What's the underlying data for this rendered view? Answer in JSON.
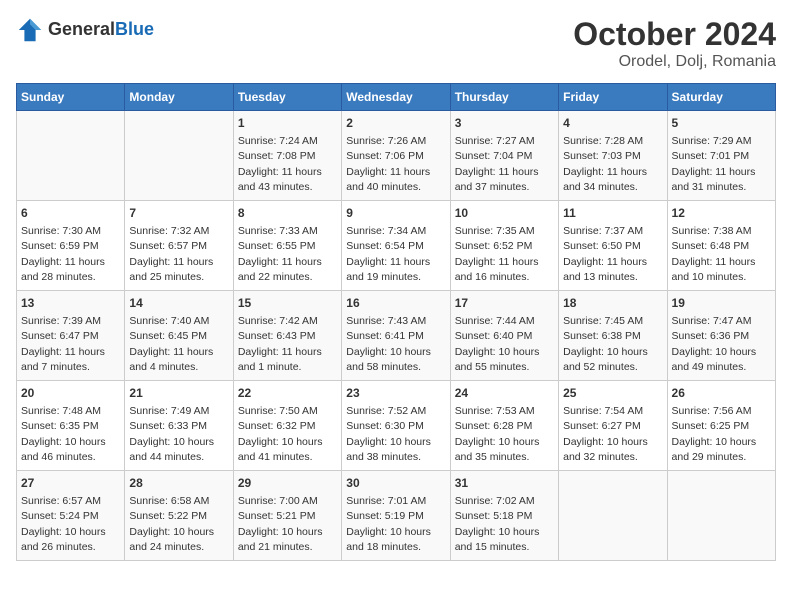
{
  "header": {
    "logo_general": "General",
    "logo_blue": "Blue",
    "title": "October 2024",
    "subtitle": "Orodel, Dolj, Romania"
  },
  "days_of_week": [
    "Sunday",
    "Monday",
    "Tuesday",
    "Wednesday",
    "Thursday",
    "Friday",
    "Saturday"
  ],
  "weeks": [
    [
      {
        "day": null
      },
      {
        "day": null
      },
      {
        "day": "1",
        "sunrise": "7:24 AM",
        "sunset": "7:08 PM",
        "daylight": "11 hours and 43 minutes."
      },
      {
        "day": "2",
        "sunrise": "7:26 AM",
        "sunset": "7:06 PM",
        "daylight": "11 hours and 40 minutes."
      },
      {
        "day": "3",
        "sunrise": "7:27 AM",
        "sunset": "7:04 PM",
        "daylight": "11 hours and 37 minutes."
      },
      {
        "day": "4",
        "sunrise": "7:28 AM",
        "sunset": "7:03 PM",
        "daylight": "11 hours and 34 minutes."
      },
      {
        "day": "5",
        "sunrise": "7:29 AM",
        "sunset": "7:01 PM",
        "daylight": "11 hours and 31 minutes."
      }
    ],
    [
      {
        "day": "6",
        "sunrise": "7:30 AM",
        "sunset": "6:59 PM",
        "daylight": "11 hours and 28 minutes."
      },
      {
        "day": "7",
        "sunrise": "7:32 AM",
        "sunset": "6:57 PM",
        "daylight": "11 hours and 25 minutes."
      },
      {
        "day": "8",
        "sunrise": "7:33 AM",
        "sunset": "6:55 PM",
        "daylight": "11 hours and 22 minutes."
      },
      {
        "day": "9",
        "sunrise": "7:34 AM",
        "sunset": "6:54 PM",
        "daylight": "11 hours and 19 minutes."
      },
      {
        "day": "10",
        "sunrise": "7:35 AM",
        "sunset": "6:52 PM",
        "daylight": "11 hours and 16 minutes."
      },
      {
        "day": "11",
        "sunrise": "7:37 AM",
        "sunset": "6:50 PM",
        "daylight": "11 hours and 13 minutes."
      },
      {
        "day": "12",
        "sunrise": "7:38 AM",
        "sunset": "6:48 PM",
        "daylight": "11 hours and 10 minutes."
      }
    ],
    [
      {
        "day": "13",
        "sunrise": "7:39 AM",
        "sunset": "6:47 PM",
        "daylight": "11 hours and 7 minutes."
      },
      {
        "day": "14",
        "sunrise": "7:40 AM",
        "sunset": "6:45 PM",
        "daylight": "11 hours and 4 minutes."
      },
      {
        "day": "15",
        "sunrise": "7:42 AM",
        "sunset": "6:43 PM",
        "daylight": "11 hours and 1 minute."
      },
      {
        "day": "16",
        "sunrise": "7:43 AM",
        "sunset": "6:41 PM",
        "daylight": "10 hours and 58 minutes."
      },
      {
        "day": "17",
        "sunrise": "7:44 AM",
        "sunset": "6:40 PM",
        "daylight": "10 hours and 55 minutes."
      },
      {
        "day": "18",
        "sunrise": "7:45 AM",
        "sunset": "6:38 PM",
        "daylight": "10 hours and 52 minutes."
      },
      {
        "day": "19",
        "sunrise": "7:47 AM",
        "sunset": "6:36 PM",
        "daylight": "10 hours and 49 minutes."
      }
    ],
    [
      {
        "day": "20",
        "sunrise": "7:48 AM",
        "sunset": "6:35 PM",
        "daylight": "10 hours and 46 minutes."
      },
      {
        "day": "21",
        "sunrise": "7:49 AM",
        "sunset": "6:33 PM",
        "daylight": "10 hours and 44 minutes."
      },
      {
        "day": "22",
        "sunrise": "7:50 AM",
        "sunset": "6:32 PM",
        "daylight": "10 hours and 41 minutes."
      },
      {
        "day": "23",
        "sunrise": "7:52 AM",
        "sunset": "6:30 PM",
        "daylight": "10 hours and 38 minutes."
      },
      {
        "day": "24",
        "sunrise": "7:53 AM",
        "sunset": "6:28 PM",
        "daylight": "10 hours and 35 minutes."
      },
      {
        "day": "25",
        "sunrise": "7:54 AM",
        "sunset": "6:27 PM",
        "daylight": "10 hours and 32 minutes."
      },
      {
        "day": "26",
        "sunrise": "7:56 AM",
        "sunset": "6:25 PM",
        "daylight": "10 hours and 29 minutes."
      }
    ],
    [
      {
        "day": "27",
        "sunrise": "6:57 AM",
        "sunset": "5:24 PM",
        "daylight": "10 hours and 26 minutes."
      },
      {
        "day": "28",
        "sunrise": "6:58 AM",
        "sunset": "5:22 PM",
        "daylight": "10 hours and 24 minutes."
      },
      {
        "day": "29",
        "sunrise": "7:00 AM",
        "sunset": "5:21 PM",
        "daylight": "10 hours and 21 minutes."
      },
      {
        "day": "30",
        "sunrise": "7:01 AM",
        "sunset": "5:19 PM",
        "daylight": "10 hours and 18 minutes."
      },
      {
        "day": "31",
        "sunrise": "7:02 AM",
        "sunset": "5:18 PM",
        "daylight": "10 hours and 15 minutes."
      },
      {
        "day": null
      },
      {
        "day": null
      }
    ]
  ]
}
